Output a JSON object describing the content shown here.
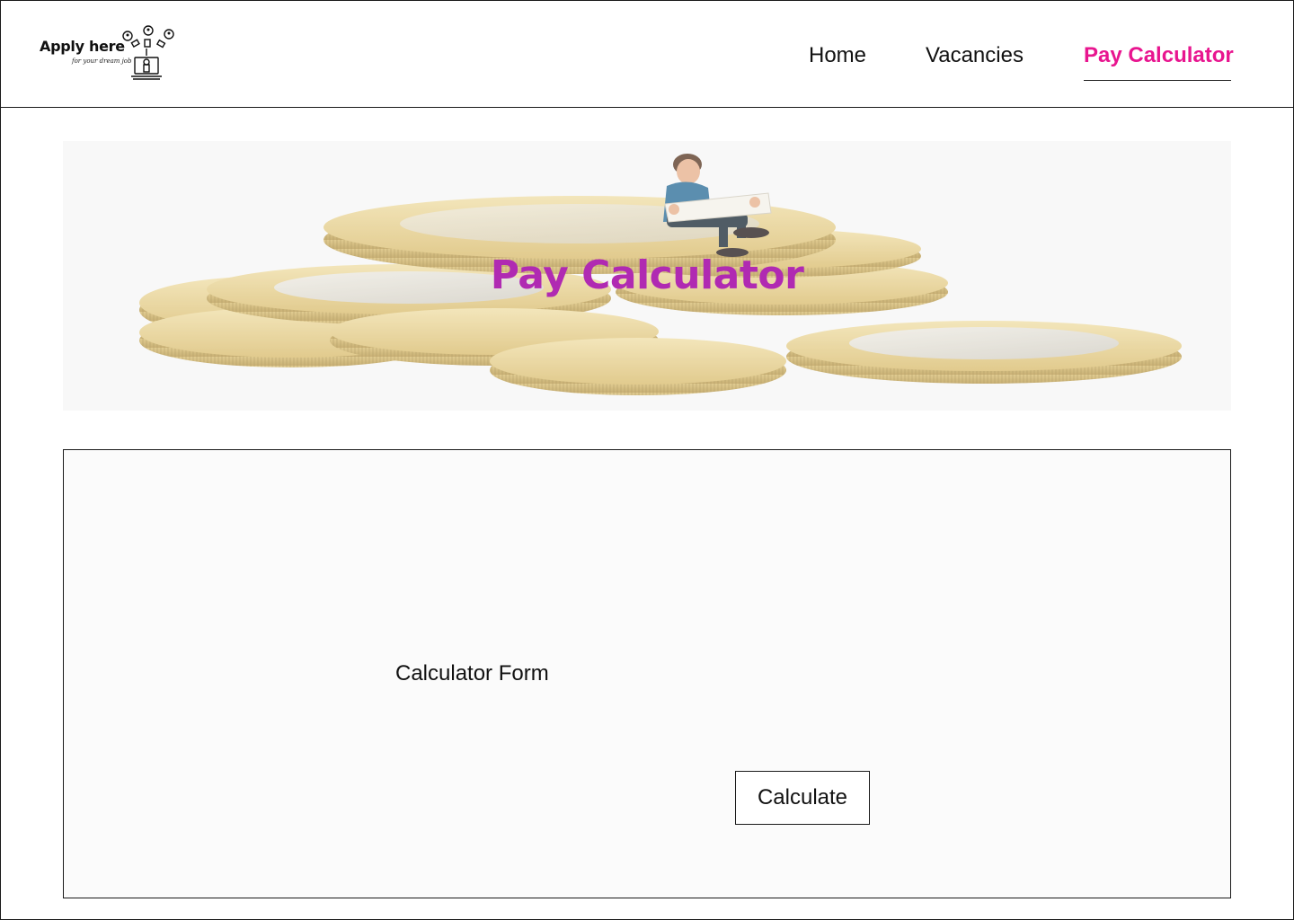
{
  "brand": {
    "name": "Apply here",
    "tagline": "for your dream job"
  },
  "nav": {
    "items": [
      {
        "label": "Home"
      },
      {
        "label": "Vacancies"
      },
      {
        "label": "Pay Calculator"
      }
    ],
    "active_color": "#e8158f"
  },
  "hero": {
    "title": "Pay Calculator",
    "title_color": "#b02ab2",
    "image": "coins-with-miniature-reading-figure"
  },
  "form": {
    "label": "Calculator Form",
    "submit_label": "Calculate"
  }
}
